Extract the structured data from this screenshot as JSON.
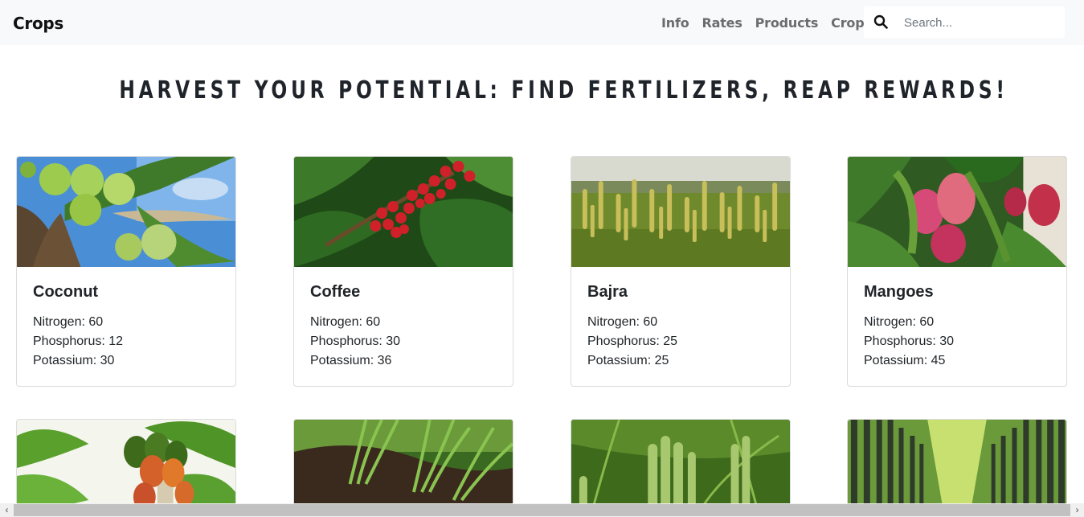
{
  "navbar": {
    "brand": "Crops",
    "links": [
      "Info",
      "Rates",
      "Products",
      "Crops"
    ],
    "search_placeholder": "Search..."
  },
  "headline": "HARVEST YOUR POTENTIAL: FIND FERTILIZERS, REAP REWARDS!",
  "crops": [
    {
      "name": "Coconut",
      "nitrogen": "Nitrogen: 60",
      "phosphorus": "Phosphorus: 12",
      "potassium": "Potassium: 30"
    },
    {
      "name": "Coffee",
      "nitrogen": "Nitrogen: 60",
      "phosphorus": "Phosphorus: 30",
      "potassium": "Potassium: 36"
    },
    {
      "name": "Bajra",
      "nitrogen": "Nitrogen: 60",
      "phosphorus": "Phosphorus: 25",
      "potassium": "Potassium: 25"
    },
    {
      "name": "Mangoes",
      "nitrogen": "Nitrogen: 60",
      "phosphorus": "Phosphorus: 30",
      "potassium": "Potassium: 45"
    }
  ],
  "scrollbar": {
    "left_arrow": "‹",
    "right_arrow": "›"
  }
}
